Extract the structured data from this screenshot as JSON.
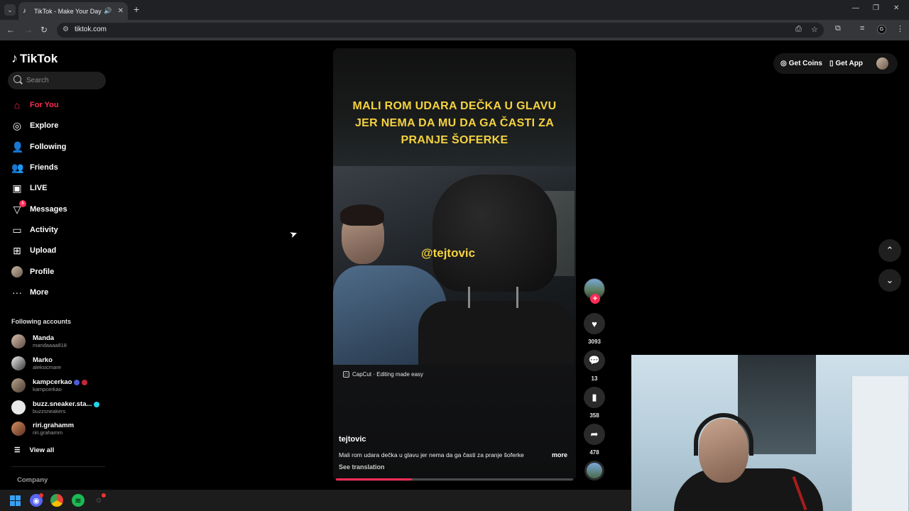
{
  "browser": {
    "tab_title": "TikTok - Make Your Day",
    "url": "tiktok.com",
    "profile_initial": "G"
  },
  "sidebar": {
    "logo": "TikTok",
    "search_placeholder": "Search",
    "nav": [
      {
        "label": "For You",
        "icon": "home-icon",
        "active": true
      },
      {
        "label": "Explore",
        "icon": "compass-icon"
      },
      {
        "label": "Following",
        "icon": "following-icon"
      },
      {
        "label": "Friends",
        "icon": "friends-icon"
      },
      {
        "label": "LIVE",
        "icon": "live-icon"
      },
      {
        "label": "Messages",
        "icon": "messages-icon",
        "badge": "6"
      },
      {
        "label": "Activity",
        "icon": "activity-icon"
      },
      {
        "label": "Upload",
        "icon": "upload-icon"
      },
      {
        "label": "Profile",
        "icon": "avatar"
      },
      {
        "label": "More",
        "icon": "more-icon"
      }
    ],
    "following_title": "Following accounts",
    "accounts": [
      {
        "name": "Manda",
        "handle": "mandaaaa818"
      },
      {
        "name": "Marko",
        "handle": "aleksicmare"
      },
      {
        "name": "kampcerkao",
        "handle": "kampcerkao"
      },
      {
        "name": "buzz.sneaker.sta...",
        "handle": "buzzsneakers"
      },
      {
        "name": "riri.grahamm",
        "handle": "riri.grahamm"
      }
    ],
    "view_all": "View all",
    "company": "Company"
  },
  "video": {
    "overlay_text": "MALI ROM UDARA DEČKA U GLAVU JER NEMA DA MU DA GA ČASTI ZA PRANJE ŠOFERKE",
    "watermark": "@tejtovic",
    "capcut": "CapCut · Editing made easy",
    "author": "tejtovic",
    "description": "Mali rom udara dečka u glavu jer nema da ga časti za pranje šoferke",
    "more": "more",
    "see_translation": "See translation",
    "progress": 0.32
  },
  "actions": {
    "likes": "3093",
    "comments": "13",
    "saves": "358",
    "shares": "478"
  },
  "header": {
    "get_coins": "Get Coins",
    "get_app": "Get App"
  },
  "colors": {
    "accent": "#fe2c55",
    "caption_yellow": "#f4d23f"
  }
}
